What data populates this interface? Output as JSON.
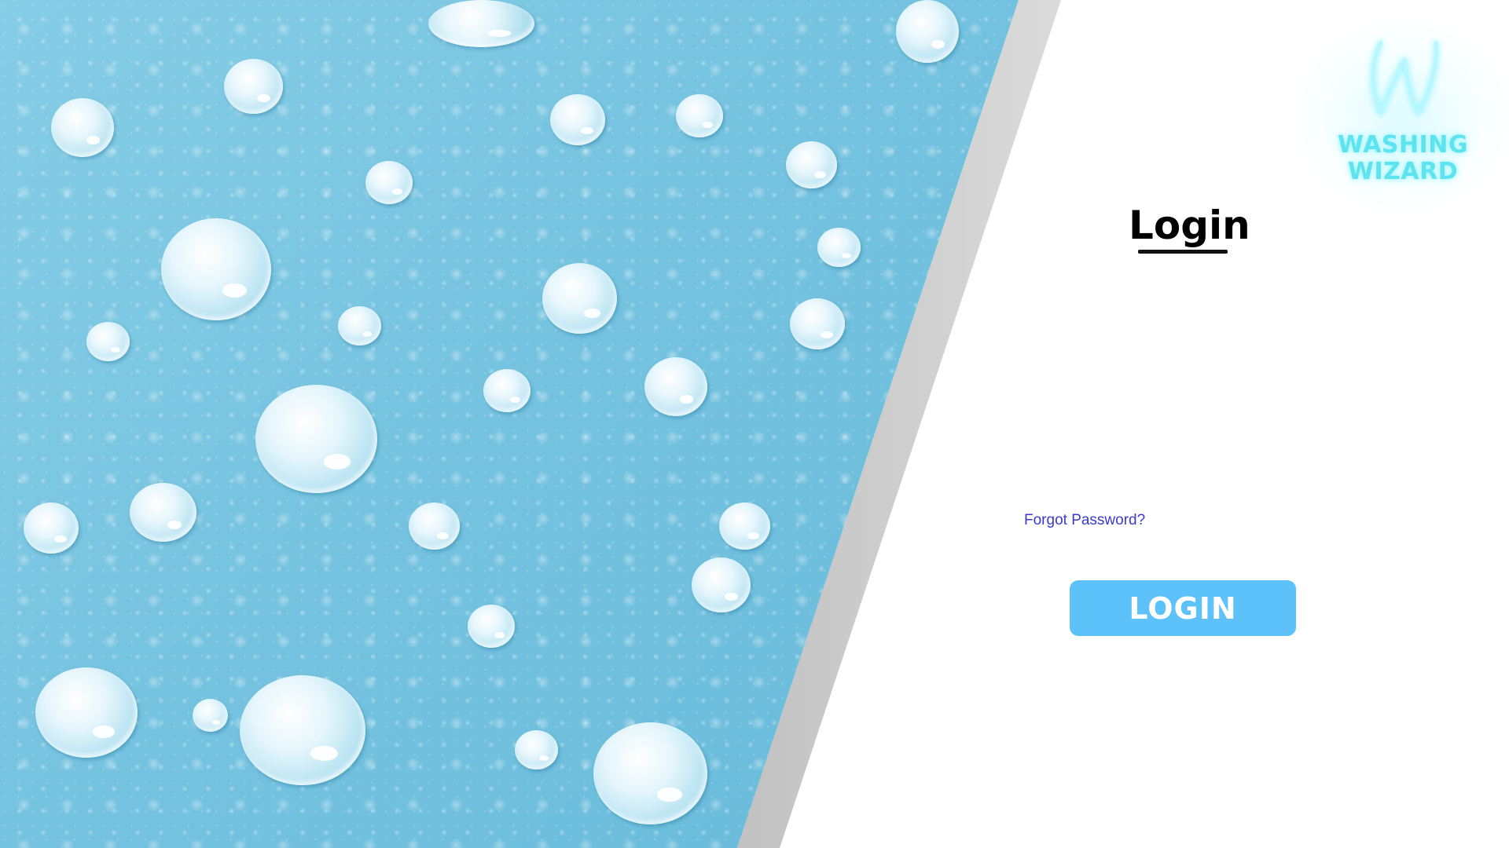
{
  "logo": {
    "line1": "WASHING",
    "line2": "WIZARD",
    "icon": "washing-wizard-w-icon",
    "color": "#5fe3ee"
  },
  "login": {
    "title": "Login",
    "forgot_password": "Forgot Password?",
    "button_label": "LOGIN"
  },
  "colors": {
    "button": "#5ec2fa",
    "link": "#3a3ad2",
    "water": "#74c2df"
  }
}
